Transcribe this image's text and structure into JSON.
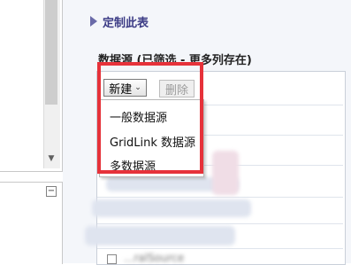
{
  "right_panel": {
    "customize_title": "定制此表",
    "data_source_label": "数据源 (已筛选 - 更多列存在)",
    "buttons": {
      "new_label": "新建",
      "delete_label": "删除"
    },
    "new_menu": {
      "items": [
        "一般数据源",
        "GridLink 数据源",
        "多数据源"
      ]
    },
    "partial_row_text": "...ralSource"
  },
  "icons": {
    "customize": "triangle-right-icon",
    "new_dropdown": "chevron-down-icon",
    "scroll_down": "arrow-down-icon",
    "collapse": "minus-box-icon"
  },
  "colors": {
    "highlight": "#e6323a",
    "title": "#3b3b85"
  }
}
